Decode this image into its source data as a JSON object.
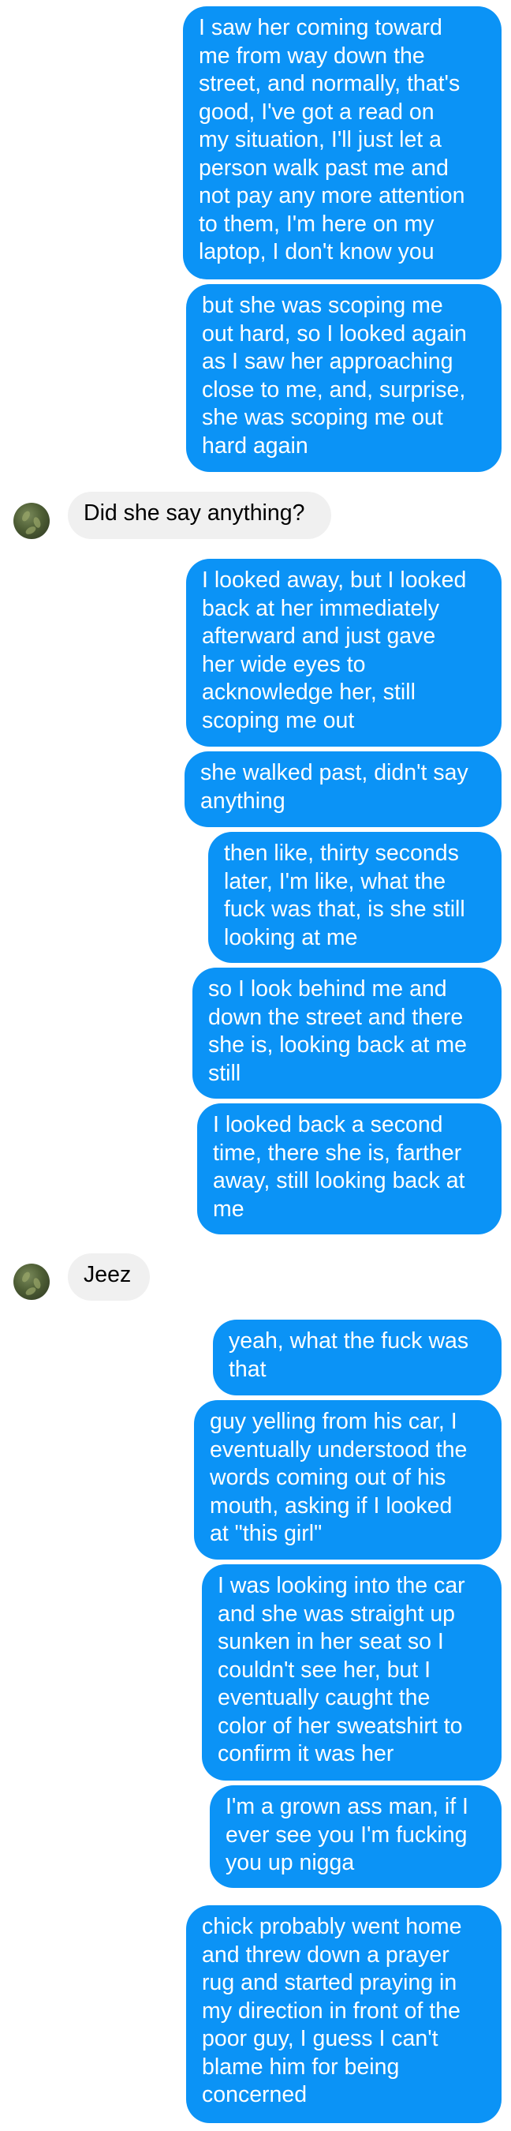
{
  "conversation": {
    "messages": [
      {
        "side": "out",
        "text": "I saw her coming toward\nme from way down the\nstreet, and normally, that's\ngood, I've got a read on\nmy situation, I'll just let a\nperson walk past me and\nnot pay any more attention\nto them, I'm here on my\nlaptop, I don't know you"
      },
      {
        "side": "out",
        "text": "but she was scoping me\nout hard, so I looked again\nas I saw her approaching\nclose to me, and, surprise,\nshe was scoping me out\nhard again"
      },
      {
        "side": "in",
        "text": "Did she say anything?"
      },
      {
        "side": "out",
        "text": "I looked away, but I looked\nback at her immediately\nafterward and just gave\nher wide eyes to\nacknowledge her, still\nscoping me out"
      },
      {
        "side": "out",
        "text": "she walked past, didn't say\nanything"
      },
      {
        "side": "out",
        "text": "then like, thirty seconds\nlater, I'm like, what the\nfuck was that, is she still\nlooking at me"
      },
      {
        "side": "out",
        "text": "so I look behind me and\ndown the street and there\nshe is, looking back at me\nstill"
      },
      {
        "side": "out",
        "text": "I looked back a second\ntime, there she is, farther\naway, still looking back at\nme"
      },
      {
        "side": "in",
        "text": "Jeez"
      },
      {
        "side": "out",
        "text": "yeah, what the fuck was\nthat"
      },
      {
        "side": "out",
        "text": "guy yelling from his car, I\neventually understood the\nwords coming out of his\nmouth, asking if I looked\nat \"this girl\""
      },
      {
        "side": "out",
        "text": "I was looking into the car\nand she was straight up\nsunken in her seat so I\ncouldn't see her, but I\neventually caught the\ncolor of her sweatshirt to\nconfirm it was her"
      },
      {
        "side": "out",
        "text": "I'm a grown ass man, if I\never see you I'm fucking\nyou up nigga"
      },
      {
        "side": "out",
        "text": "chick probably went home\nand threw down a prayer\nrug and started praying in\nmy direction in front of the\npoor guy, I guess I can't\nblame him for being\nconcerned"
      }
    ]
  },
  "colors": {
    "outgoing_bubble": "#0b93f6",
    "incoming_bubble": "#f0f0f0"
  },
  "icons": {
    "contact_avatar": "avatar-icon"
  }
}
